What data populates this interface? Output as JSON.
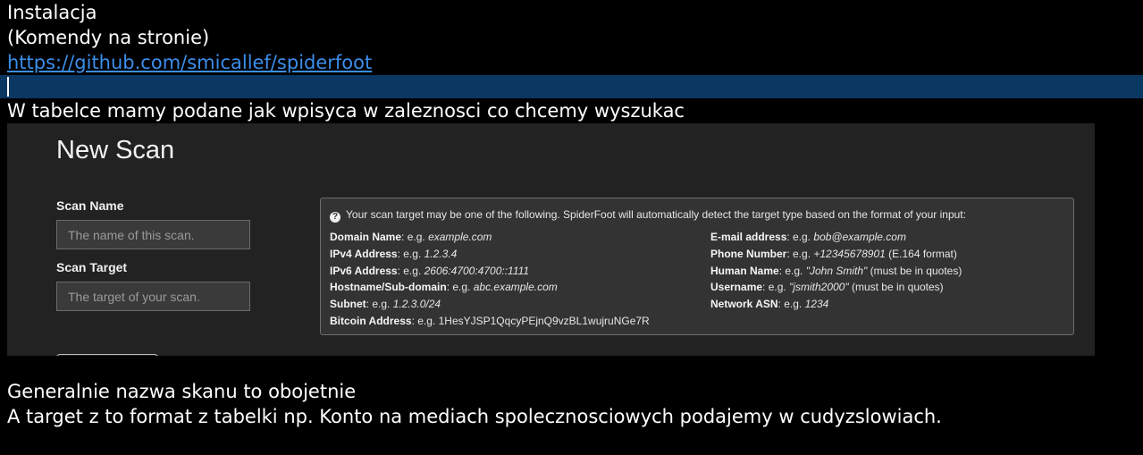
{
  "notes": {
    "line1": "Instalacja",
    "line2": "(Komendy na stronie)",
    "link": "https://github.com/smicallef/spiderfoot",
    "line4": "W tabelce mamy podane jak wpisyca w zaleznosci co chcemy wyszukac",
    "line5": "Generalnie nazwa skanu to obojetnie",
    "line6": "A target z to format z tabelki np. Konto na mediach spolecznosciowych podajemy w cudyzslowiach."
  },
  "screenshot": {
    "title": "New Scan",
    "scan_name_label": "Scan Name",
    "scan_name_placeholder": "The name of this scan.",
    "scan_target_label": "Scan Target",
    "scan_target_placeholder": "The target of your scan.",
    "info": {
      "icon": "question-circle-icon",
      "header": "Your scan target may be one of the following. SpiderFoot will automatically detect the target type based on the format of your input:",
      "left": [
        {
          "label": "Domain Name",
          "sep": ": e.g. ",
          "example": "example.com",
          "italic": true,
          "suffix": ""
        },
        {
          "label": "IPv4 Address",
          "sep": ": e.g. ",
          "example": "1.2.3.4",
          "italic": true,
          "suffix": ""
        },
        {
          "label": "IPv6 Address",
          "sep": ": e.g. ",
          "example": "2606:4700:4700::1111",
          "italic": true,
          "suffix": ""
        },
        {
          "label": "Hostname/Sub-domain",
          "sep": ": e.g. ",
          "example": "abc.example.com",
          "italic": true,
          "suffix": ""
        },
        {
          "label": "Subnet",
          "sep": ": e.g. ",
          "example": "1.2.3.0/24",
          "italic": true,
          "suffix": ""
        },
        {
          "label": "Bitcoin Address",
          "sep": ": e.g. ",
          "example": "1HesYJSP1QqcyPEjnQ9vzBL1wujruNGe7R",
          "italic": false,
          "suffix": ""
        }
      ],
      "right": [
        {
          "label": "E-mail address",
          "sep": ": e.g. ",
          "example": "bob@example.com",
          "italic": true,
          "suffix": ""
        },
        {
          "label": "Phone Number",
          "sep": ": e.g. ",
          "example": "+12345678901",
          "italic": true,
          "suffix": " (E.164 format)"
        },
        {
          "label": "Human Name",
          "sep": ": e.g. ",
          "example": "\"John Smith\"",
          "italic": true,
          "suffix": " (must be in quotes)"
        },
        {
          "label": "Username",
          "sep": ": e.g. ",
          "example": "\"jsmith2000\"",
          "italic": true,
          "suffix": " (must be in quotes)"
        },
        {
          "label": "Network ASN",
          "sep": ": e.g. ",
          "example": "1234",
          "italic": true,
          "suffix": ""
        }
      ]
    }
  }
}
